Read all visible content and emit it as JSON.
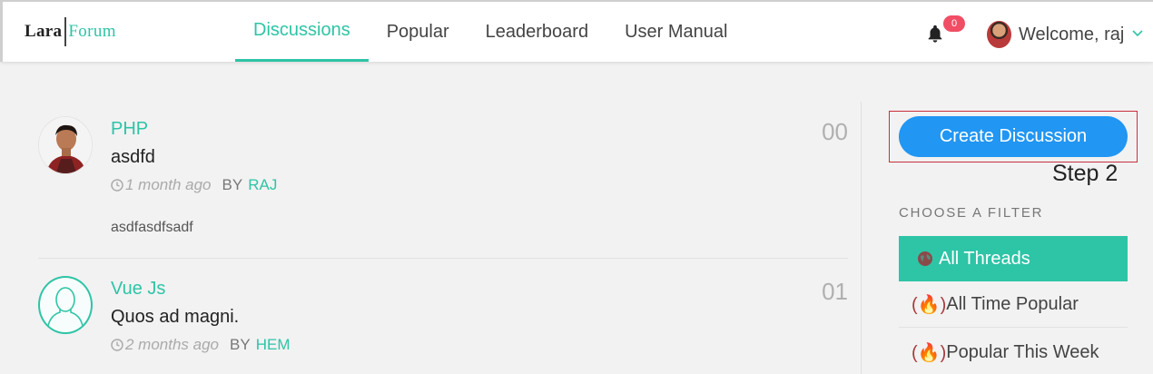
{
  "header": {
    "logo": {
      "left": "Lara",
      "right": "Forum"
    },
    "nav": [
      {
        "label": "Discussions",
        "active": true
      },
      {
        "label": "Popular",
        "active": false
      },
      {
        "label": "Leaderboard",
        "active": false
      },
      {
        "label": "User Manual",
        "active": false
      }
    ],
    "notifications": {
      "count": "0",
      "icon": "bell-icon"
    },
    "welcome": "Welcome, raj",
    "user_menu_icon": "chevron-down-icon"
  },
  "threads": [
    {
      "category": "PHP",
      "title": "asdfd",
      "time": "1 month ago",
      "by_label": "BY",
      "author": "RAJ",
      "body": "asdfasdfsadf",
      "replies": "00",
      "avatar": "user-photo"
    },
    {
      "category": "Vue Js",
      "title": "Quos ad magni.",
      "time": "2 months ago",
      "by_label": "BY",
      "author": "HEM",
      "replies": "01",
      "avatar": "default-user-icon"
    }
  ],
  "sidebar": {
    "create_button": "Create Discussion",
    "annotation": "Step 2",
    "filter_heading": "CHOOSE A FILTER",
    "filters": [
      {
        "label": "All Threads",
        "icon": "globe-icon",
        "active": true
      },
      {
        "label": "All Time Popular",
        "icon": "fire-icon",
        "active": false
      },
      {
        "label": "Popular This Week",
        "icon": "fire-icon",
        "active": false
      }
    ]
  },
  "colors": {
    "accent": "#2ec4a6",
    "primary_button": "#2196f3",
    "badge": "#f04e64",
    "annotation_box": "#c9303e"
  }
}
